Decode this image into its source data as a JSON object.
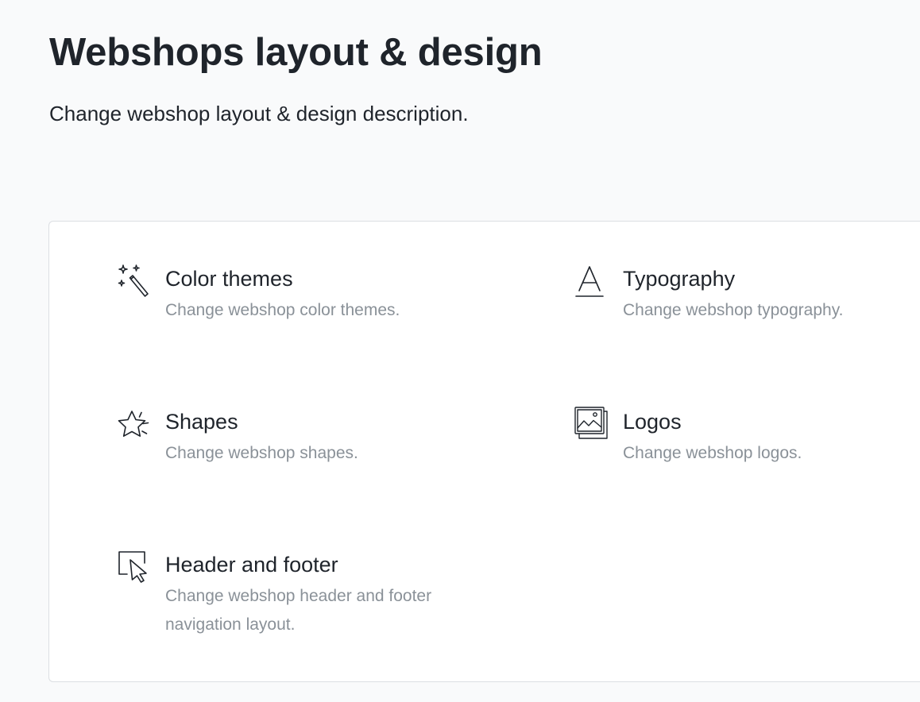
{
  "page": {
    "title": "Webshops layout & design",
    "description": "Change webshop layout & design description."
  },
  "options": [
    {
      "title": "Color themes",
      "description": "Change webshop color themes.",
      "icon": "magic-wand-icon"
    },
    {
      "title": "Typography",
      "description": "Change webshop typography.",
      "icon": "typography-icon"
    },
    {
      "title": "Shapes",
      "description": "Change webshop shapes.",
      "icon": "star-icon"
    },
    {
      "title": "Logos",
      "description": "Change webshop logos.",
      "icon": "images-icon"
    },
    {
      "title": "Header and footer",
      "description": "Change webshop header and footer navigation layout.",
      "icon": "cursor-icon"
    }
  ],
  "colors": {
    "background": "#f9fafb",
    "text": "#1f242b",
    "muted": "#8a9198",
    "border": "#dcdfe3"
  }
}
